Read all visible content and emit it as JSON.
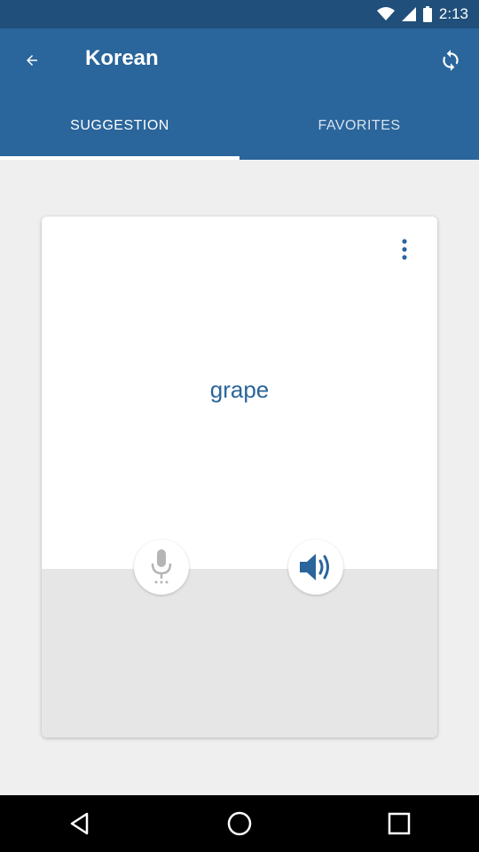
{
  "status_bar": {
    "time": "2:13"
  },
  "app_bar": {
    "title": "Korean"
  },
  "tabs": [
    {
      "label": "SUGGESTION",
      "active": true
    },
    {
      "label": "FAVORITES",
      "active": false
    }
  ],
  "card": {
    "word": "grape"
  },
  "icons": {
    "back": "back-arrow-icon",
    "refresh": "refresh-icon",
    "more": "more-vertical-icon",
    "mic": "microphone-icon",
    "speaker": "speaker-icon"
  },
  "colors": {
    "primary": "#2a659b",
    "status_bar": "#1f4f7a",
    "accent_text": "#2a659b"
  }
}
